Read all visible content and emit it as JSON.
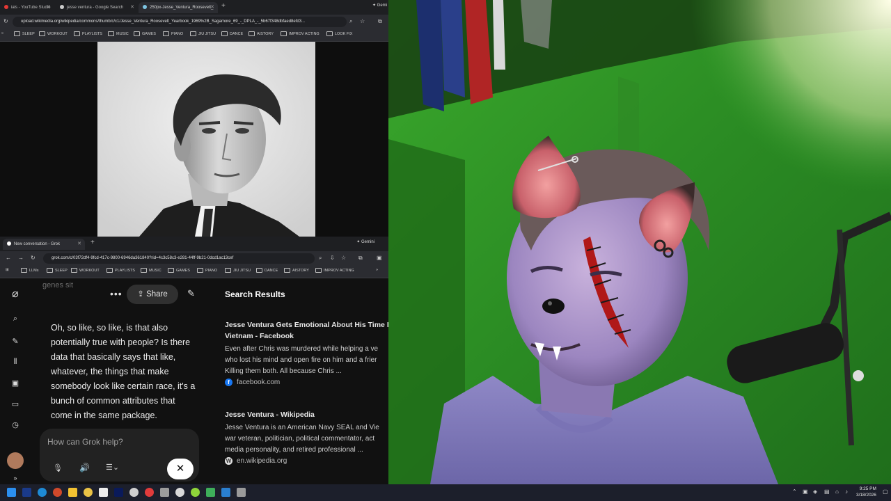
{
  "top_browser": {
    "tabs": [
      {
        "label": "ials - YouTube Studio",
        "active": false
      },
      {
        "label": "jesse ventura - Google Search",
        "active": false
      },
      {
        "label": "250px-Jesse_Ventura_Roosevelt_",
        "active": true
      }
    ],
    "gemini_label": "Gemi",
    "url": "upload.wikimedia.org/wikipedia/commons/thumb/c/c1/Jesse_Ventura_Roosevelt_Yearbook_1969%2B_Sagamore_69_-_DPLA_-_5b67f348dbfaed8efd3...",
    "bookmarks": [
      "SLEEP",
      "WORKOUT",
      "PLAYLISTS",
      "MUSIC",
      "GAMES",
      "PIANO",
      "JIU JITSU",
      "DANCE",
      "AISTORY",
      "IMPROV ACTING",
      "LOOK FIX"
    ]
  },
  "bottom_browser": {
    "tabs": [
      {
        "label": "New conversation - Grok",
        "active": true
      }
    ],
    "gemini_label": "Gemini",
    "url": "grok.com/c/03f72df4-9fcd-417c-9800-6946da361840?rid=4c3c58c3-e281-44ff-9b21-0dcd1ac13cef",
    "bookmarks": [
      "LLMs",
      "SLEEP",
      "WORKOUT",
      "PLAYLISTS",
      "MUSIC",
      "GAMES",
      "PIANO",
      "JIU JITSU",
      "DANCE",
      "AISTORY",
      "IMPROV ACTING"
    ]
  },
  "grok": {
    "partial_heading": "genes sit",
    "share_label": "Share",
    "message": "Oh, so like, so like, is that also potentially true with people? Is there data that basically says that like, whatever, the things that make somebody look like certain race, it's a bunch of common attributes that come in the same package.",
    "composer_placeholder": "How can Grok help?",
    "close_symbol": "✕",
    "search_results_heading": "Search Results",
    "results": [
      {
        "title": "Jesse Ventura Gets Emotional About His Time In",
        "title2": "Vietnam - Facebook",
        "lines": [
          "Even after Chris was murdered while helping a ve",
          "who lost his mind and open fire on him and a frier",
          "Killing them both. All because Chris ..."
        ],
        "source": "facebook.com",
        "source_color": "#1877f2"
      },
      {
        "title": "Jesse Ventura - Wikipedia",
        "title2": "",
        "lines": [
          "Jesse Ventura is an American Navy SEAL and Vie",
          "war veteran, politician, political commentator, act",
          "media personality, and retired professional ..."
        ],
        "source": "en.wikipedia.org",
        "source_color": "#e0e0e0"
      }
    ]
  },
  "taskbar": {
    "time": "9:25 PM",
    "date": "3/18/2026"
  },
  "colors": {
    "wall_green": "#2f9a26",
    "taskbar_bg": "#1c1f2b"
  }
}
